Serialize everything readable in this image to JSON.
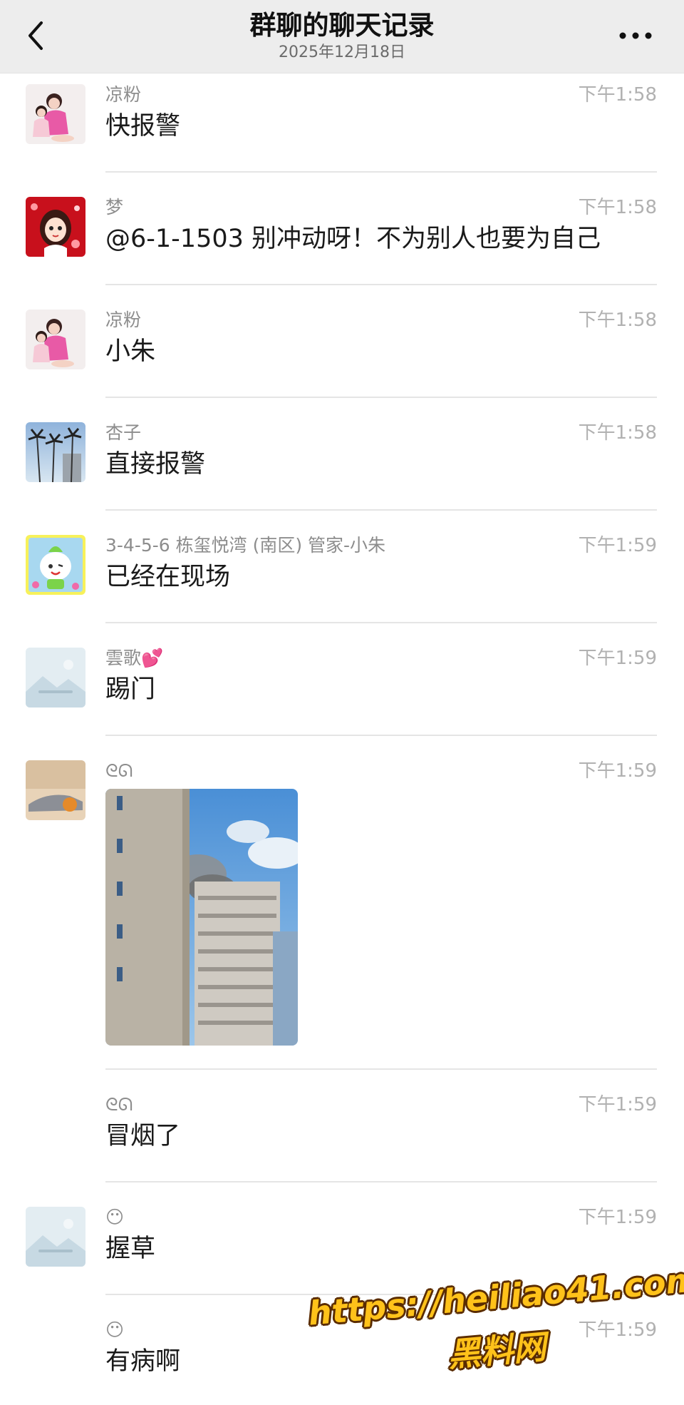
{
  "header": {
    "title": "群聊的聊天记录",
    "date": "2025年12月18日"
  },
  "messages": [
    {
      "sender": "凉粉",
      "time": "下午1:58",
      "text": "快报警",
      "avatar": "girls-photo-avatar"
    },
    {
      "sender": "梦",
      "time": "下午1:58",
      "text": "@6-1-1503 别冲动呀！不为别人也要为自己",
      "avatar": "cartoon-girl-red-avatar"
    },
    {
      "sender": "凉粉",
      "time": "下午1:58",
      "text": "小朱",
      "avatar": "girls-photo-avatar"
    },
    {
      "sender": "杏子",
      "time": "下午1:58",
      "text": "直接报警",
      "avatar": "palm-trees-avatar"
    },
    {
      "sender": "3-4-5-6 栋玺悦湾 (南区) 管家-小朱",
      "time": "下午1:59",
      "text": "已经在现场",
      "avatar": "green-cartoon-avatar"
    },
    {
      "sender": "雲歌",
      "sender_emoji": "💕",
      "time": "下午1:59",
      "text": "踢门",
      "avatar": "placeholder-landscape-avatar"
    },
    {
      "sender": "ᘓᘏ",
      "time": "下午1:59",
      "image": "burning-building-photo",
      "avatar": "sleeping-person-avatar"
    },
    {
      "sender": "ᘓᘏ",
      "time": "下午1:59",
      "text": "冒烟了"
    },
    {
      "sender": "😶",
      "time": "下午1:59",
      "text": "握草",
      "avatar": "placeholder-landscape-avatar"
    },
    {
      "sender": "😶",
      "time": "下午1:59",
      "text": "有病啊"
    }
  ],
  "watermark": {
    "url": "https://heiliao41.com",
    "name": "黑料网"
  },
  "colors": {
    "header_bg": "#ededed",
    "watermark_fill": "#ffc21a",
    "watermark_outline": "#5a2c00"
  }
}
